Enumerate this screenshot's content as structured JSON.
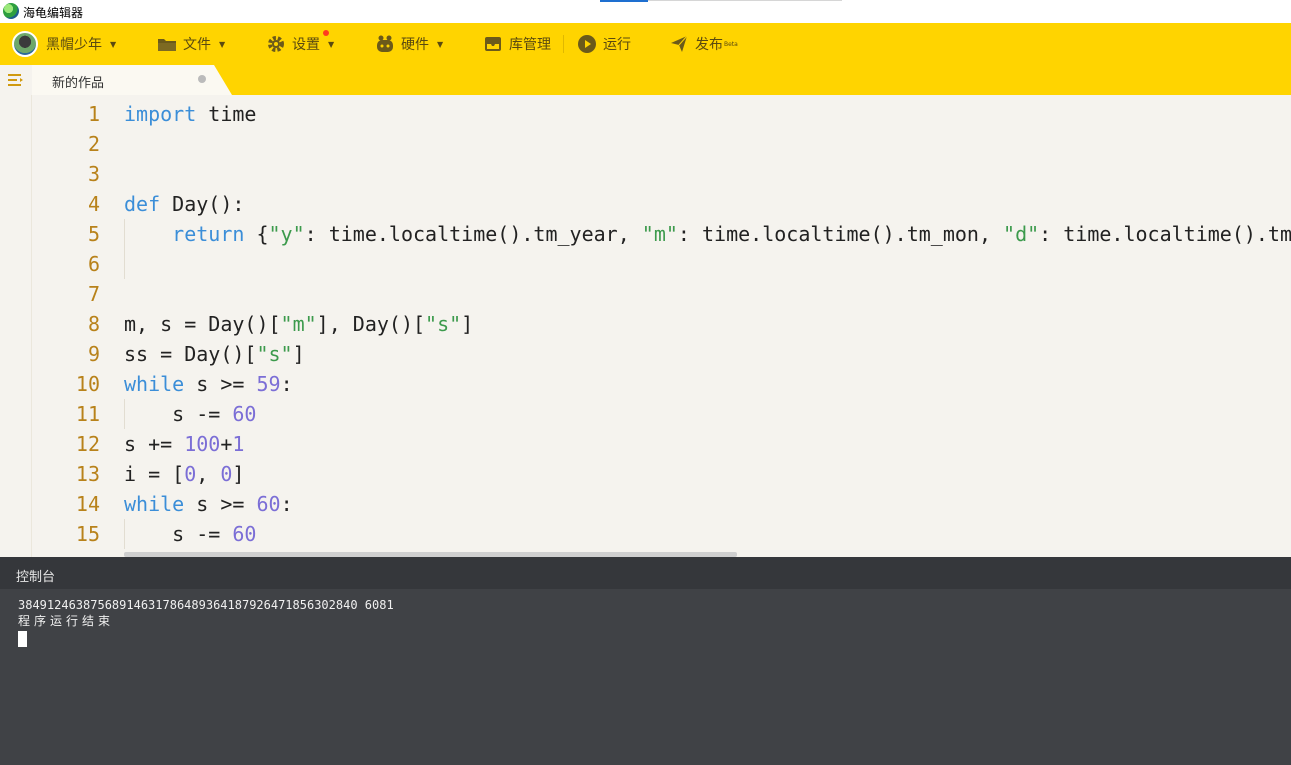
{
  "window": {
    "title": "海龟编辑器"
  },
  "toolbar": {
    "user": "黑帽少年",
    "file": "文件",
    "settings": "设置",
    "hardware": "硬件",
    "library": "库管理",
    "run": "运行",
    "publish": "发布",
    "publish_badge": "Beta"
  },
  "tab": {
    "title": "新的作品"
  },
  "editor": {
    "line_numbers": [
      "1",
      "2",
      "3",
      "4",
      "5",
      "6",
      "7",
      "8",
      "9",
      "10",
      "11",
      "12",
      "13",
      "14",
      "15"
    ]
  },
  "console": {
    "title": "控制台",
    "output": "38491246387568914631786489364187926471856302840 6081",
    "status": "程序运行结束"
  }
}
